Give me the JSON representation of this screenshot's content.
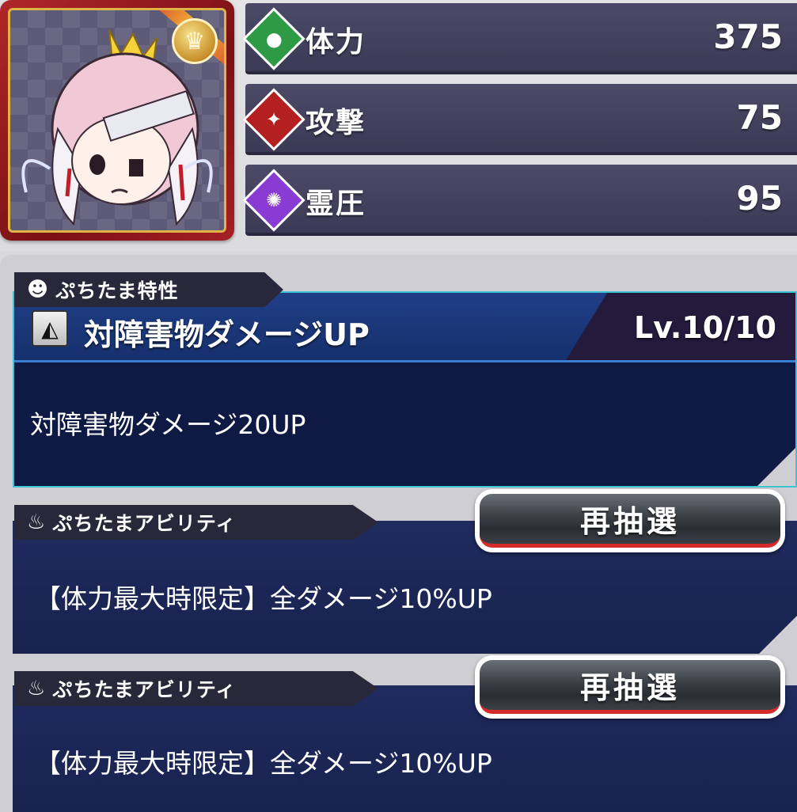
{
  "stats": [
    {
      "icon": "hp-gem-icon",
      "label": "体力",
      "value": "375",
      "color": "#2e9a45"
    },
    {
      "icon": "attack-gem-icon",
      "label": "攻撃",
      "value": "75",
      "color": "#b3201f"
    },
    {
      "icon": "spirit-gem-icon",
      "label": "霊圧",
      "value": "95",
      "color": "#8a3bd4"
    }
  ],
  "trait": {
    "tab_label": "ぷちたま特性",
    "title": "対障害物ダメージUP",
    "level": "Lv.10/10",
    "description": "対障害物ダメージ20UP"
  },
  "abilities": [
    {
      "tab_label": "ぷちたまアビリティ",
      "button_label": "再抽選",
      "text": "【体力最大時限定】全ダメージ10%UP"
    },
    {
      "tab_label": "ぷちたまアビリティ",
      "button_label": "再抽選",
      "text": "【体力最大時限定】全ダメージ10%UP"
    }
  ],
  "colors": {
    "accent_border": "#3ec3d4",
    "button_stripe": "#d42a2a"
  }
}
